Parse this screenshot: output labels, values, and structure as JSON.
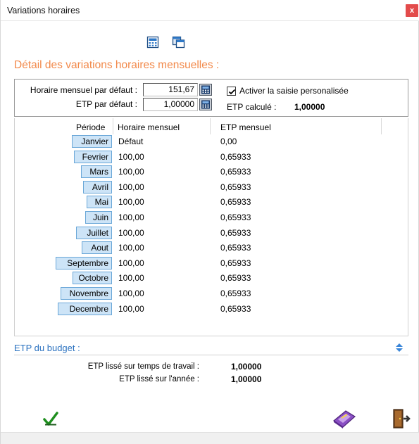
{
  "window": {
    "title": "Variations horaires",
    "close_label": "x"
  },
  "toolbar": {
    "icons": [
      "calculator-icon",
      "copy-window-icon"
    ]
  },
  "section": {
    "title": "Détail des variations horaires mensuelles :"
  },
  "defaults": {
    "horaire_label": "Horaire mensuel par défaut :",
    "horaire_value": "151,67",
    "etp_label": "ETP par défaut :",
    "etp_value": "1,00000",
    "checkbox_label": "Activer la saisie personalisée",
    "checkbox_checked": true,
    "etp_calc_label": "ETP calculé :",
    "etp_calc_value": "1,00000"
  },
  "grid": {
    "headers": {
      "periode": "Période",
      "horaire": "Horaire mensuel",
      "etp": "ETP mensuel"
    },
    "rows": [
      {
        "month": "Janvier",
        "horaire": "Défaut",
        "etp": "0,00"
      },
      {
        "month": "Fevrier",
        "horaire": "100,00",
        "etp": "0,65933"
      },
      {
        "month": "Mars",
        "horaire": "100,00",
        "etp": "0,65933"
      },
      {
        "month": "Avril",
        "horaire": "100,00",
        "etp": "0,65933"
      },
      {
        "month": "Mai",
        "horaire": "100,00",
        "etp": "0,65933"
      },
      {
        "month": "Juin",
        "horaire": "100,00",
        "etp": "0,65933"
      },
      {
        "month": "Juillet",
        "horaire": "100,00",
        "etp": "0,65933"
      },
      {
        "month": "Aout",
        "horaire": "100,00",
        "etp": "0,65933"
      },
      {
        "month": "Septembre",
        "horaire": "100,00",
        "etp": "0,65933"
      },
      {
        "month": "Octobre",
        "horaire": "100,00",
        "etp": "0,65933"
      },
      {
        "month": "Novembre",
        "horaire": "100,00",
        "etp": "0,65933"
      },
      {
        "month": "Decembre",
        "horaire": "100,00",
        "etp": "0,65933"
      }
    ]
  },
  "budget": {
    "title": "ETP du budget :",
    "lisse_travail_label": "ETP lissé sur temps de travail :",
    "lisse_travail_value": "1,00000",
    "lisse_annee_label": "ETP lissé sur l'année :",
    "lisse_annee_value": "1,00000"
  },
  "footer": {
    "icons": [
      "validate-check-icon",
      "eraser-icon",
      "exit-door-icon"
    ]
  },
  "colors": {
    "accent_orange": "#f2894a",
    "accent_blue": "#2b72c0",
    "month_button_bg": "#cde4f7",
    "close_red": "#e34b4b"
  }
}
